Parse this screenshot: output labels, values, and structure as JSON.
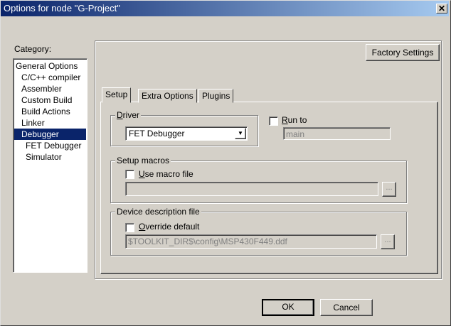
{
  "window": {
    "title": "Options for node \"G-Project\"",
    "close_glyph": "✕"
  },
  "category": {
    "label": "Category:",
    "items": [
      {
        "label": "General Options",
        "selected": false
      },
      {
        "label": "C/C++ compiler",
        "selected": false
      },
      {
        "label": "Assembler",
        "selected": false
      },
      {
        "label": "Custom Build",
        "selected": false
      },
      {
        "label": "Build Actions",
        "selected": false
      },
      {
        "label": "Linker",
        "selected": false
      },
      {
        "label": "Debugger",
        "selected": true
      },
      {
        "label": "FET Debugger",
        "selected": false
      },
      {
        "label": "Simulator",
        "selected": false
      }
    ]
  },
  "factory_settings_label": "Factory Settings",
  "tabs": [
    {
      "label": "Setup",
      "active": true
    },
    {
      "label": "Extra Options",
      "active": false
    },
    {
      "label": "Plugins",
      "active": false
    }
  ],
  "driver": {
    "group_label_u": "D",
    "group_label_rest": "river",
    "selected": "FET Debugger"
  },
  "run_to": {
    "label_u": "R",
    "label_rest": "un to",
    "checked": false,
    "value": "main"
  },
  "setup_macros": {
    "group_label": "Setup macros",
    "checkbox_label_u": "U",
    "checkbox_label_rest": "se macro file",
    "checked": false,
    "value": "",
    "browse_label": "..."
  },
  "device_description": {
    "group_label": "Device description file",
    "checkbox_label_u": "O",
    "checkbox_label_rest": "verride default",
    "checked": false,
    "value": "$TOOLKIT_DIR$\\config\\MSP430F449.ddf",
    "browse_label": "..."
  },
  "buttons": {
    "ok": "OK",
    "cancel": "Cancel"
  }
}
